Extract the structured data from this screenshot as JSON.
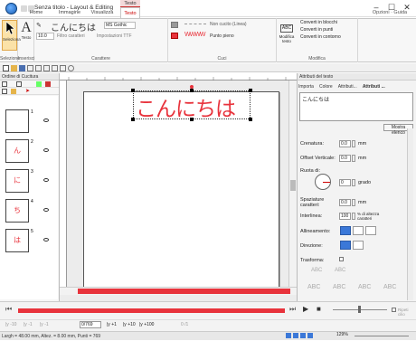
{
  "app": {
    "title": "Senza titolo - Layout & Editing",
    "context_tab": "Testo",
    "window_controls": {
      "minimize": "–",
      "maximize": "☐",
      "close": "✕"
    }
  },
  "ribbon_tabs": [
    {
      "label": "Home"
    },
    {
      "label": "Immagine"
    },
    {
      "label": "Visualizza"
    },
    {
      "label": "Testo"
    }
  ],
  "ribbon_right": "Opzioni · Guida",
  "ribbon": {
    "selection": {
      "select_label": "Seleziona",
      "text_label": "Testo",
      "group1": "Selezione",
      "group2": "Inserisci"
    },
    "character": {
      "text_value": "こんにちは",
      "font": "MS Gothic",
      "size": "10.0",
      "filter": "Filtro caratteri",
      "ttf": "Impostazioni TTF",
      "group": "Carattere"
    },
    "stitches": {
      "line1": "Non cucito (Linea)",
      "line2": "Punto pieno",
      "group": "Cuci"
    },
    "modify": {
      "edit_text": "Modifica testo",
      "abc": "ABC",
      "convert1": "Converti in blocchi",
      "convert2": "Converti in punti",
      "convert3": "Converti in contorno",
      "group": "Modifica"
    }
  },
  "left_panel": {
    "title": "Ordine di Cucitura",
    "items": [
      {
        "num": "1",
        "glyph": ""
      },
      {
        "num": "2",
        "glyph": "ん"
      },
      {
        "num": "3",
        "glyph": "に"
      },
      {
        "num": "4",
        "glyph": "ち"
      },
      {
        "num": "5",
        "glyph": "は"
      }
    ]
  },
  "canvas": {
    "text": "こんにちは"
  },
  "right_panel": {
    "title": "Attributi del testo",
    "tabs": [
      "Importa",
      "Colore",
      "Attributi...",
      "Attributi ..."
    ],
    "text_value": "こんにちは",
    "show_list": "Mostra elenco",
    "fields": {
      "crenatura_label": "Crenatura:",
      "crenatura_value": "0.0",
      "offset_label": "Offset Verticale:",
      "offset_value": "0.0",
      "rotation_label": "Ruota di:",
      "rotation_value": "0",
      "rotation_unit": "grado",
      "spacing_label": "Spaziature caratteri:",
      "spacing_value": "0.0",
      "interlinea_label": "Interlinea:",
      "interlinea_value": "100",
      "interlinea_unit": "% di altezza caratteri",
      "unit": "mm",
      "align_label": "Allineamento:",
      "direction_label": "Direzione:",
      "transform_label": "Trasforma:"
    },
    "transform_samples": [
      "ABC",
      "ABC",
      "ABC",
      "ABC",
      "ABC",
      "ABC"
    ]
  },
  "bottom": {
    "stitch_count": "0/769",
    "x_labels": [
      "|y -10",
      "|y -1",
      "|y -1",
      "|y +1",
      "|y +10",
      "|y +100"
    ],
    "page": "0 /1",
    "repeat_label": "Ripeti cilio"
  },
  "status": {
    "text": "Largh = 48.00 mm, Altez. = 8.00 mm, Punti = 769",
    "zoom": "129%"
  },
  "colors": {
    "accent": "#c00000",
    "thread_red": "#e8333c",
    "ribbon_bg": "#f7f7f7"
  }
}
